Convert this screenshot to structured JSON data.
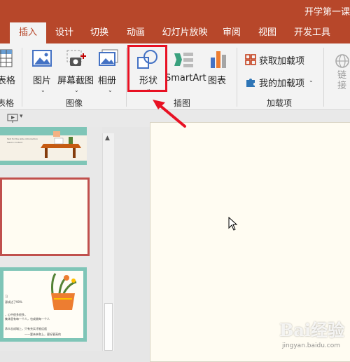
{
  "title": "开学第一课",
  "tabs": [
    {
      "label": "插入",
      "active": true
    },
    {
      "label": "设计"
    },
    {
      "label": "切换"
    },
    {
      "label": "动画"
    },
    {
      "label": "幻灯片放映"
    },
    {
      "label": "审阅"
    },
    {
      "label": "视图"
    },
    {
      "label": "开发工具"
    }
  ],
  "ribbon": {
    "table_label": "表格",
    "table_group": "表格",
    "picture_label": "图片",
    "screenshot_label": "屏幕截图",
    "album_label": "相册",
    "images_group": "图像",
    "shapes_label": "形状",
    "smartart_label": "SmartArt",
    "chart_label": "图表",
    "illustrations_group": "插图",
    "get_addins_label": "获取加载项",
    "my_addins_label": "我的加载项",
    "addins_group": "加载项",
    "link_label": "链接"
  },
  "slides": {
    "thumb1_text": [
      "Text for the slide introduction",
      "lesson content"
    ],
    "thumb3_text": [
      "习",
      "源成达了90%",
      "，心中很多很多，",
      "集体里有每一个人，也成就每一个人",
      "承众志成城上，只有充实才能远遥",
      "——要亲亲和上，更好更高的"
    ]
  },
  "watermark": "Bai经验",
  "watermark_sub": "jingyan.baidu.com",
  "colors": {
    "brand": "#b7472a",
    "highlight": "#e81123",
    "slide_bg": "#fffcf2",
    "teal": "#7fc5b7"
  }
}
